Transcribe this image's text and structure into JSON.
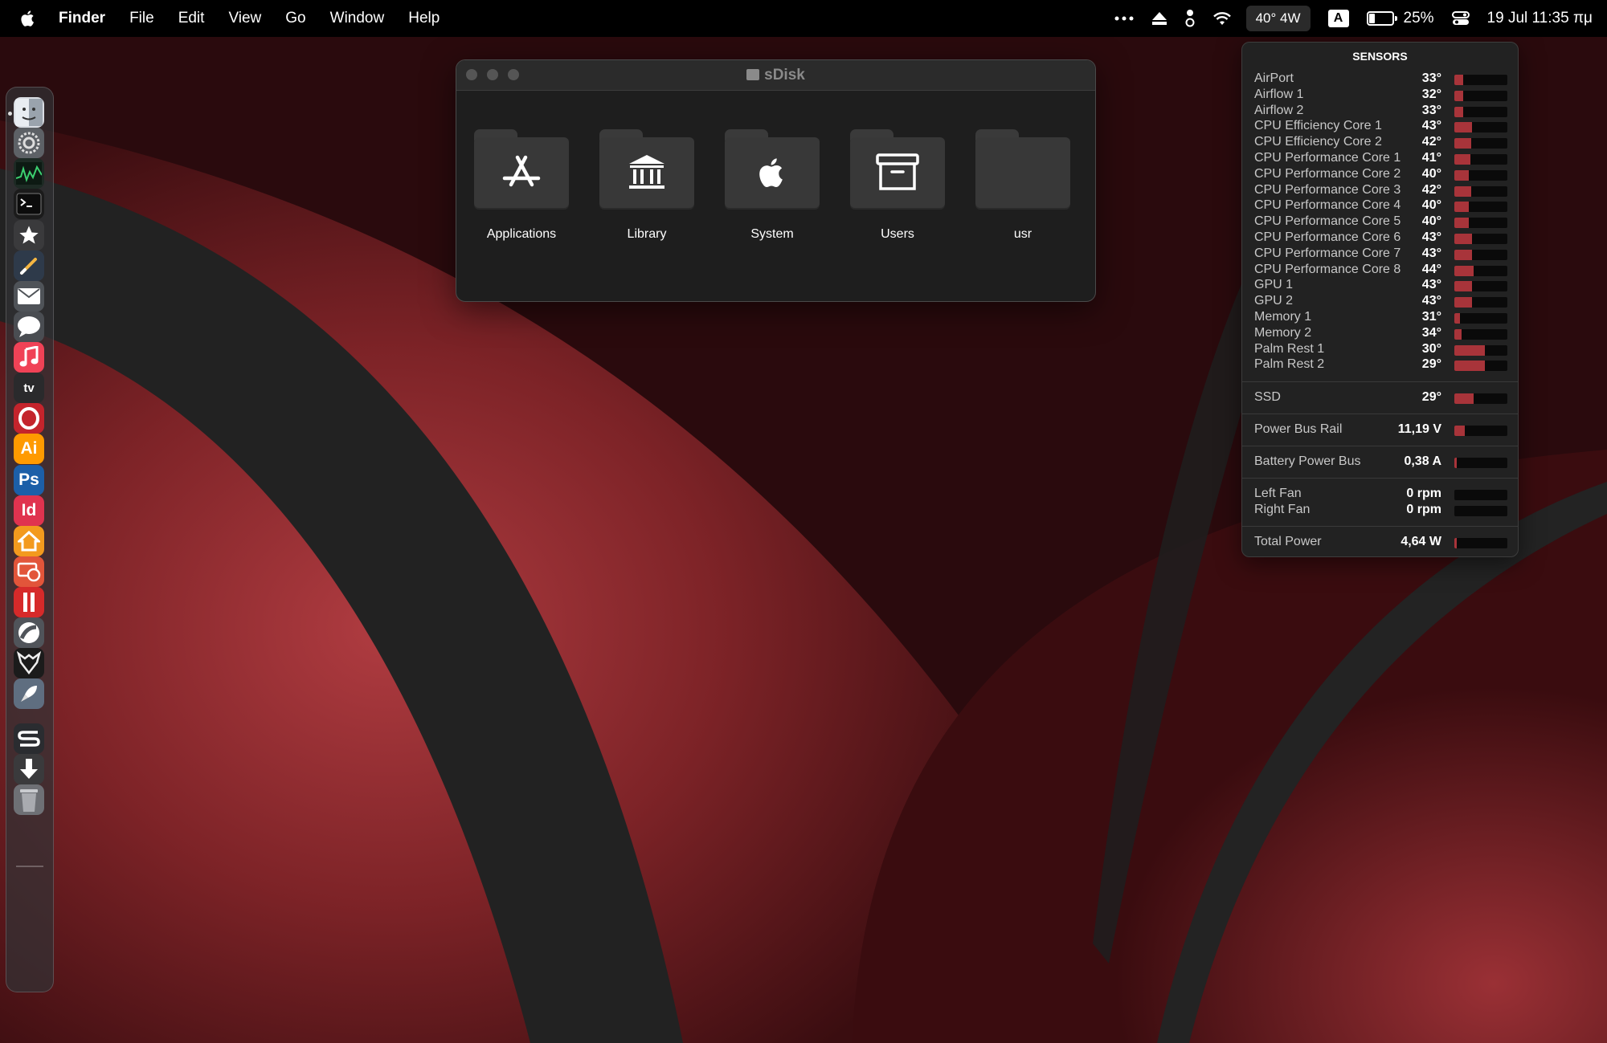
{
  "menubar": {
    "app_name": "Finder",
    "menus": [
      "File",
      "Edit",
      "View",
      "Go",
      "Window",
      "Help"
    ],
    "sensor_readout": "40° 4W",
    "input_source": "A",
    "battery_percent": "25%",
    "battery_level": 0.25,
    "datetime": "19 Jul  11:35 πμ"
  },
  "dock": {
    "apps": [
      {
        "name": "finder",
        "icon": "finder-icon",
        "color": "#d9dde3"
      },
      {
        "name": "system-settings",
        "icon": "gear-icon",
        "color": "#5d6166"
      },
      {
        "name": "activity-monitor",
        "icon": "activity-monitor-icon",
        "color": "#1d2a24"
      },
      {
        "name": "terminal",
        "icon": "terminal-icon",
        "color": "#1b1b1b"
      },
      {
        "name": "reeder",
        "icon": "star-icon",
        "color": "#3a3a3c"
      },
      {
        "name": "pen-app",
        "icon": "pen-icon",
        "color": "#2e3a4a"
      },
      {
        "name": "mail",
        "icon": "envelope-icon",
        "color": "#4f5358"
      },
      {
        "name": "messages",
        "icon": "speech-bubble-icon",
        "color": "#4a4d52"
      },
      {
        "name": "music",
        "icon": "music-note-icon",
        "color": "#f04256"
      },
      {
        "name": "apple-tv",
        "icon": "tv-icon",
        "color": "#2a2a2c"
      },
      {
        "name": "opera",
        "icon": "opera-icon",
        "color": "#c4242c"
      },
      {
        "name": "illustrator",
        "icon": "illustrator-icon",
        "color": "#ff9a00",
        "text": "Ai"
      },
      {
        "name": "photoshop",
        "icon": "photoshop-icon",
        "color": "#1c5fa8",
        "text": "Ps"
      },
      {
        "name": "indesign",
        "icon": "indesign-icon",
        "color": "#e0334f",
        "text": "Id"
      },
      {
        "name": "home",
        "icon": "house-icon",
        "color": "#f39a1e"
      },
      {
        "name": "screens",
        "icon": "screens-icon",
        "color": "#e2553a"
      },
      {
        "name": "parallels",
        "icon": "parallels-icon",
        "color": "#d62a2a"
      },
      {
        "name": "davinci",
        "icon": "aperture-icon",
        "color": "#50545a"
      },
      {
        "name": "witcher",
        "icon": "wolf-icon",
        "color": "#1b1b1b"
      },
      {
        "name": "launchpad",
        "icon": "rocket-icon",
        "color": "#5f6e80"
      },
      {
        "name": "sketch-like",
        "icon": "swirl-icon",
        "color": "#2a2c30"
      },
      {
        "name": "downloads",
        "icon": "download-icon",
        "color": "#3a3a3c"
      },
      {
        "name": "trash",
        "icon": "trash-icon",
        "color": "#6e7075"
      }
    ]
  },
  "finder": {
    "title": "sDisk",
    "folders": [
      {
        "label": "Applications",
        "icon": "app-store-icon"
      },
      {
        "label": "Library",
        "icon": "library-columns-icon"
      },
      {
        "label": "System",
        "icon": "apple-icon"
      },
      {
        "label": "Users",
        "icon": "archive-box-icon"
      },
      {
        "label": "usr",
        "icon": ""
      }
    ]
  },
  "sensors": {
    "title": "SENSORS",
    "temps": [
      {
        "name": "AirPort",
        "value": "33°",
        "level": 0.16
      },
      {
        "name": "Airflow 1",
        "value": "32°",
        "level": 0.16
      },
      {
        "name": "Airflow 2",
        "value": "33°",
        "level": 0.16
      },
      {
        "name": "CPU Efficiency Core 1",
        "value": "43°",
        "level": 0.34
      },
      {
        "name": "CPU Efficiency Core 2",
        "value": "42°",
        "level": 0.32
      },
      {
        "name": "CPU Performance Core 1",
        "value": "41°",
        "level": 0.3
      },
      {
        "name": "CPU Performance Core 2",
        "value": "40°",
        "level": 0.28
      },
      {
        "name": "CPU Performance Core 3",
        "value": "42°",
        "level": 0.32
      },
      {
        "name": "CPU Performance Core 4",
        "value": "40°",
        "level": 0.28
      },
      {
        "name": "CPU Performance Core 5",
        "value": "40°",
        "level": 0.28
      },
      {
        "name": "CPU Performance Core 6",
        "value": "43°",
        "level": 0.34
      },
      {
        "name": "CPU Performance Core 7",
        "value": "43°",
        "level": 0.34
      },
      {
        "name": "CPU Performance Core 8",
        "value": "44°",
        "level": 0.36
      },
      {
        "name": "GPU 1",
        "value": "43°",
        "level": 0.34
      },
      {
        "name": "GPU 2",
        "value": "43°",
        "level": 0.34
      },
      {
        "name": "Memory 1",
        "value": "31°",
        "level": 0.1
      },
      {
        "name": "Memory 2",
        "value": "34°",
        "level": 0.14
      },
      {
        "name": "Palm Rest 1",
        "value": "30°",
        "level": 0.58
      },
      {
        "name": "Palm Rest 2",
        "value": "29°",
        "level": 0.58
      }
    ],
    "ssd": {
      "name": "SSD",
      "value": "29°",
      "level": 0.36
    },
    "power_rail": {
      "name": "Power Bus Rail",
      "value": "11,19 V",
      "level": 0.2
    },
    "battery_bus": {
      "name": "Battery Power Bus",
      "value": "0,38 A",
      "level": 0.05
    },
    "fans": [
      {
        "name": "Left Fan",
        "value": "0 rpm",
        "level": 0.0
      },
      {
        "name": "Right Fan",
        "value": "0 rpm",
        "level": 0.0
      }
    ],
    "total_power": {
      "name": "Total Power",
      "value": "4,64 W",
      "level": 0.05
    },
    "bar_color": "#a8343a"
  }
}
